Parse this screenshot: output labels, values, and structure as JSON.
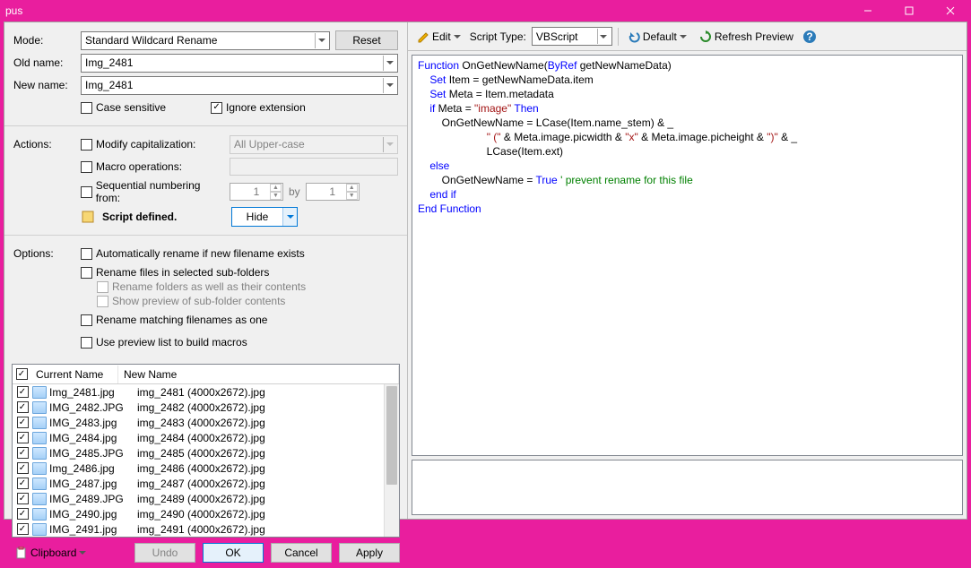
{
  "window": {
    "title": "pus"
  },
  "mode": {
    "label": "Mode:",
    "value": "Standard Wildcard Rename",
    "reset": "Reset"
  },
  "oldname": {
    "label": "Old name:",
    "value": "Img_2481"
  },
  "newname": {
    "label": "New name:",
    "value": "Img_2481"
  },
  "flags": {
    "case_sensitive": "Case sensitive",
    "ignore_ext": "Ignore extension"
  },
  "actions": {
    "label": "Actions:",
    "modify_cap": "Modify capitalization:",
    "cap_mode": "All Upper-case",
    "macro": "Macro operations:",
    "seq": "Sequential numbering from:",
    "seq_start": "1",
    "seq_by": "by",
    "seq_step": "1",
    "script_defined": "Script defined.",
    "hide": "Hide"
  },
  "options": {
    "label": "Options:",
    "auto_rename": "Automatically rename if new filename exists",
    "rename_sub": "Rename files in selected sub-folders",
    "rename_folders": "Rename folders as well as their contents",
    "show_preview": "Show preview of sub-folder contents",
    "rename_match": "Rename matching filenames as one",
    "use_preview": "Use preview list to build macros"
  },
  "list": {
    "col_current": "Current Name",
    "col_new": "New Name",
    "rows": [
      {
        "cur": "Img_2481.jpg",
        "new": "img_2481 (4000x2672).jpg"
      },
      {
        "cur": "IMG_2482.JPG",
        "new": "img_2482 (4000x2672).jpg"
      },
      {
        "cur": "IMG_2483.jpg",
        "new": "img_2483 (4000x2672).jpg"
      },
      {
        "cur": "IMG_2484.jpg",
        "new": "img_2484 (4000x2672).jpg"
      },
      {
        "cur": "IMG_2485.JPG",
        "new": "img_2485 (4000x2672).jpg"
      },
      {
        "cur": "Img_2486.jpg",
        "new": "img_2486 (4000x2672).jpg"
      },
      {
        "cur": "IMG_2487.jpg",
        "new": "img_2487 (4000x2672).jpg"
      },
      {
        "cur": "IMG_2489.JPG",
        "new": "img_2489 (4000x2672).jpg"
      },
      {
        "cur": "IMG_2490.jpg",
        "new": "img_2490 (4000x2672).jpg"
      },
      {
        "cur": "IMG_2491.jpg",
        "new": "img_2491 (4000x2672).jpg"
      }
    ]
  },
  "buttons": {
    "clipboard": "Clipboard",
    "undo": "Undo",
    "ok": "OK",
    "cancel": "Cancel",
    "apply": "Apply"
  },
  "toolbar": {
    "edit": "Edit",
    "script_type_label": "Script Type:",
    "script_type": "VBScript",
    "default": "Default",
    "refresh": "Refresh Preview"
  },
  "script": {
    "l1a": "Function",
    "l1b": " OnGetNewName(",
    "l1c": "ByRef",
    "l1d": " getNewNameData)",
    "l2a": "    ",
    "l2b": "Set",
    "l2c": " Item = getNewNameData.item",
    "l3a": "    ",
    "l3b": "Set",
    "l3c": " Meta = Item.metadata",
    "l4a": "    ",
    "l4b": "if",
    "l4c": " Meta = ",
    "l4d": "\"image\"",
    "l4e": " ",
    "l4f": "Then",
    "l5a": "        OnGetNewName = LCase(Item.name_stem) & _",
    "l6a": "                       ",
    "l6b": "\" (\"",
    "l6c": " & Meta.image.picwidth & ",
    "l6d": "\"x\"",
    "l6e": " & Meta.image.picheight & ",
    "l6f": "\")\"",
    "l6g": " & _",
    "l7a": "                       LCase(Item.ext)",
    "l8a": "    ",
    "l8b": "else",
    "l9a": "        OnGetNewName = ",
    "l9b": "True",
    "l9c": " ",
    "l9d": "' prevent rename for this file",
    "l10a": "    ",
    "l10b": "end if",
    "l11a": "End Function"
  }
}
